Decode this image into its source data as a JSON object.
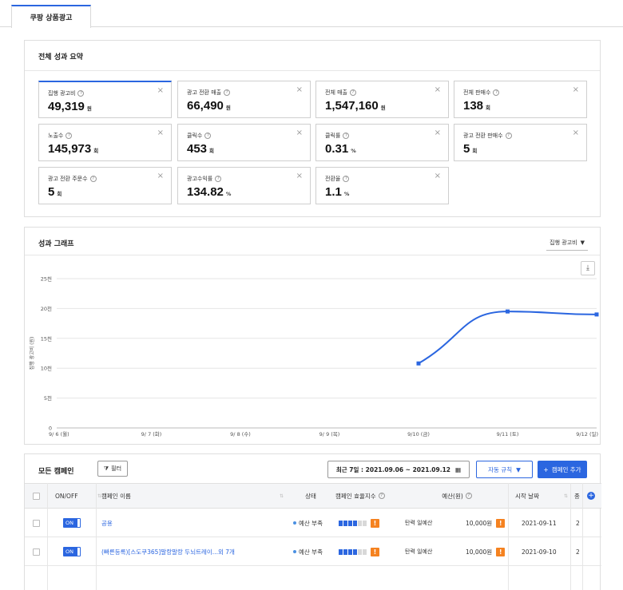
{
  "tabs": {
    "active": "쿠팡 상품광고"
  },
  "summary": {
    "title": "전체 성과 요약",
    "cards": [
      {
        "label": "집행 광고비",
        "value": "49,319",
        "unit": "원"
      },
      {
        "label": "광고 전환 매출",
        "value": "66,490",
        "unit": "원"
      },
      {
        "label": "전체 매출",
        "value": "1,547,160",
        "unit": "원"
      },
      {
        "label": "전체 판매수",
        "value": "138",
        "unit": "회"
      },
      {
        "label": "노출수",
        "value": "145,973",
        "unit": "회"
      },
      {
        "label": "클릭수",
        "value": "453",
        "unit": "회"
      },
      {
        "label": "클릭률",
        "value": "0.31",
        "unit": "%"
      },
      {
        "label": "광고 전환 판매수",
        "value": "5",
        "unit": "회"
      },
      {
        "label": "광고 전환 주문수",
        "value": "5",
        "unit": "회"
      },
      {
        "label": "광고수익률",
        "value": "134.82",
        "unit": "%"
      },
      {
        "label": "전환율",
        "value": "1.1",
        "unit": "%"
      }
    ],
    "close_glyph": "×",
    "help_glyph": "?"
  },
  "graph": {
    "title": "성과 그래프",
    "metric": "집행 광고비",
    "download_glyph": "⤓"
  },
  "chart_data": {
    "type": "line",
    "categories": [
      "9/ 6 (월)",
      "9/ 7 (화)",
      "9/ 8 (수)",
      "9/ 9 (목)",
      "9/10 (금)",
      "9/11 (토)",
      "9/12 (일)"
    ],
    "series": [
      {
        "values": [
          null,
          null,
          null,
          null,
          10800,
          19500,
          19000
        ]
      }
    ],
    "yticks": [
      "0",
      "5천",
      "10천",
      "15천",
      "20천",
      "25천"
    ],
    "ylim": [
      0,
      25000
    ],
    "ylabel": "집행 광고비 (원)",
    "grid": true,
    "color": "#2b66e0"
  },
  "campaigns": {
    "title": "모든 캠페인",
    "filter_label": "필터",
    "date_range": "최근 7일 : 2021.09.06 ~ 2021.09.12",
    "auto_rule_label": "자동 규칙",
    "add_label": "캠페인 추가",
    "columns": {
      "onoff": "ON/OFF",
      "name": "캠페인 이름",
      "status": "상태",
      "efficiency": "캠페인 효율지수",
      "budget": "예산(원)",
      "start": "시작 날짜",
      "end": "종"
    },
    "rows": [
      {
        "toggle": "ON",
        "name": "공용",
        "status": "예산 부족",
        "budget_type": "탄력 일예산",
        "budget": "10,000원",
        "start": "2021-09-11",
        "end": "2"
      },
      {
        "toggle": "ON",
        "name": "(빠른등록)[스도쿠365]말랑말랑 두뇌트레이...외 7개",
        "status": "예산 부족",
        "budget_type": "탄력 일예산",
        "budget": "10,000원",
        "start": "2021-09-10",
        "end": "2"
      }
    ]
  }
}
